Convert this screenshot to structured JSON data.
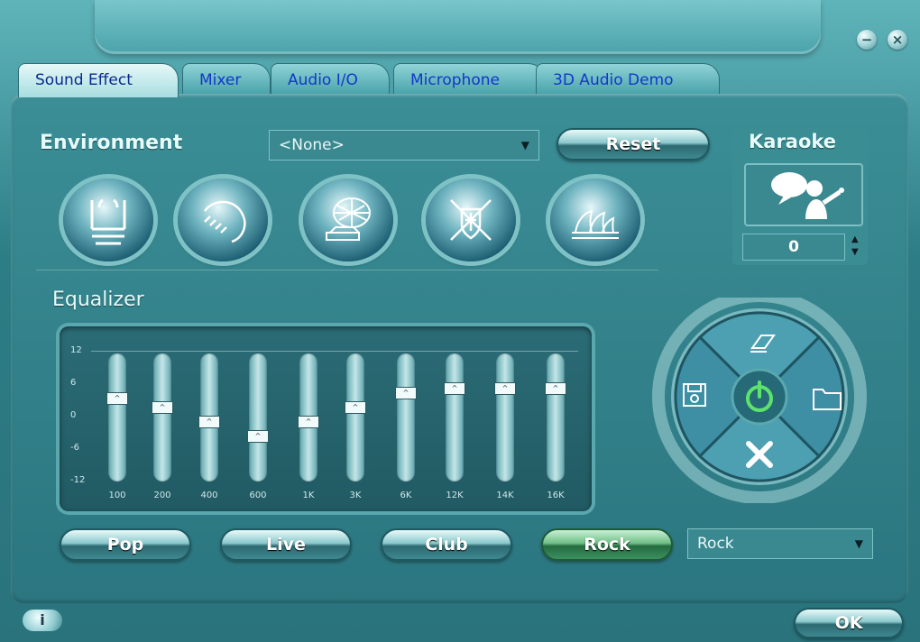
{
  "window": {
    "minimize_label": "−",
    "close_label": "×"
  },
  "tabs": [
    {
      "label": "Sound Effect",
      "active": true
    },
    {
      "label": "Mixer"
    },
    {
      "label": "Audio I/O"
    },
    {
      "label": "Microphone"
    },
    {
      "label": "3D Audio Demo"
    }
  ],
  "environment": {
    "title": "Environment",
    "selected": "<None>",
    "reset_label": "Reset",
    "presets": [
      "bathroom-icon",
      "shower-icon",
      "stadium-icon",
      "colosseum-icon",
      "opera-house-icon"
    ]
  },
  "karaoke": {
    "title": "Karaoke",
    "value": "0",
    "up": "▲",
    "down": "▼"
  },
  "equalizer": {
    "title": "Equalizer",
    "axis": [
      "12",
      "6",
      "0",
      "-6",
      "-12"
    ],
    "bands": [
      {
        "freq": "100",
        "level": 4
      },
      {
        "freq": "200",
        "level": 2
      },
      {
        "freq": "400",
        "level": -1
      },
      {
        "freq": "600",
        "level": -4
      },
      {
        "freq": "1K",
        "level": -1
      },
      {
        "freq": "3K",
        "level": 2
      },
      {
        "freq": "6K",
        "level": 5
      },
      {
        "freq": "12K",
        "level": 6
      },
      {
        "freq": "14K",
        "level": 6
      },
      {
        "freq": "16K",
        "level": 6
      }
    ],
    "presets": [
      {
        "label": "Pop"
      },
      {
        "label": "Live"
      },
      {
        "label": "Club"
      },
      {
        "label": "Rock",
        "active": true
      }
    ],
    "preset_selected": "Rock"
  },
  "wheel": {
    "top": "eraser-icon",
    "left": "save-icon",
    "right": "folder-icon",
    "bottom": "delete-icon",
    "center": "power-icon"
  },
  "footer": {
    "info_label": "i",
    "ok_label": "OK"
  }
}
